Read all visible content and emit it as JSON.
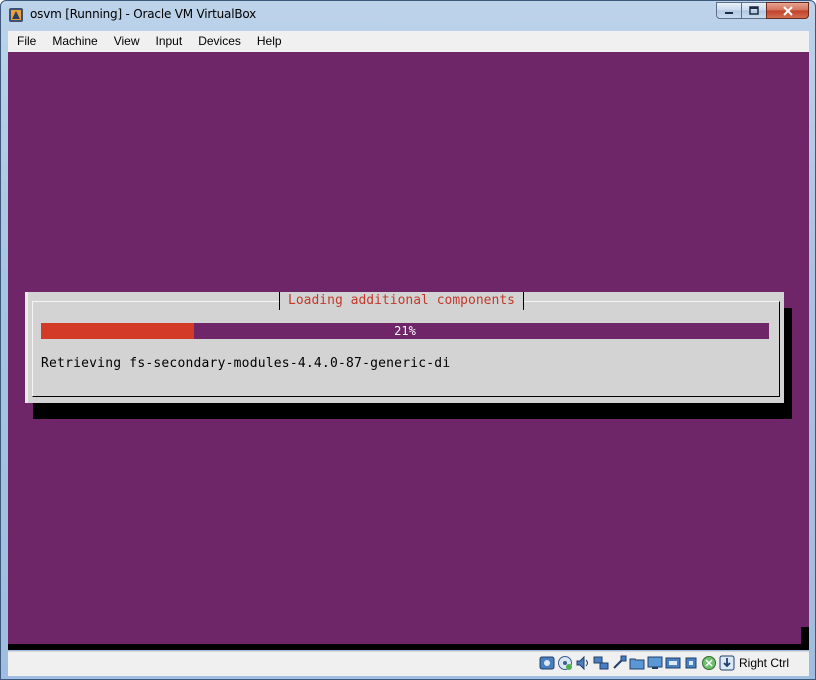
{
  "window": {
    "title": "osvm [Running] - Oracle VM VirtualBox"
  },
  "menubar": {
    "items": [
      {
        "label": "File"
      },
      {
        "label": "Machine"
      },
      {
        "label": "View"
      },
      {
        "label": "Input"
      },
      {
        "label": "Devices"
      },
      {
        "label": "Help"
      }
    ]
  },
  "installer": {
    "dialog_title": "Loading additional components",
    "progress_percent": 21,
    "progress_label": "21%",
    "status_message": "Retrieving fs-secondary-modules-4.4.0-87-generic-di"
  },
  "statusbar": {
    "icons": [
      "hard-disk-icon",
      "optical-drive-icon",
      "audio-icon",
      "network-icon",
      "usb-icon",
      "shared-folder-icon",
      "display-icon",
      "video-capture-icon",
      "cpu-icon",
      "mouse-integration-icon",
      "keyboard-icon"
    ],
    "host_key_label": "Right Ctrl"
  },
  "colors": {
    "vm_background": "#6f2669",
    "progress_fill": "#d43a28",
    "dialog_title": "#c0392b"
  }
}
